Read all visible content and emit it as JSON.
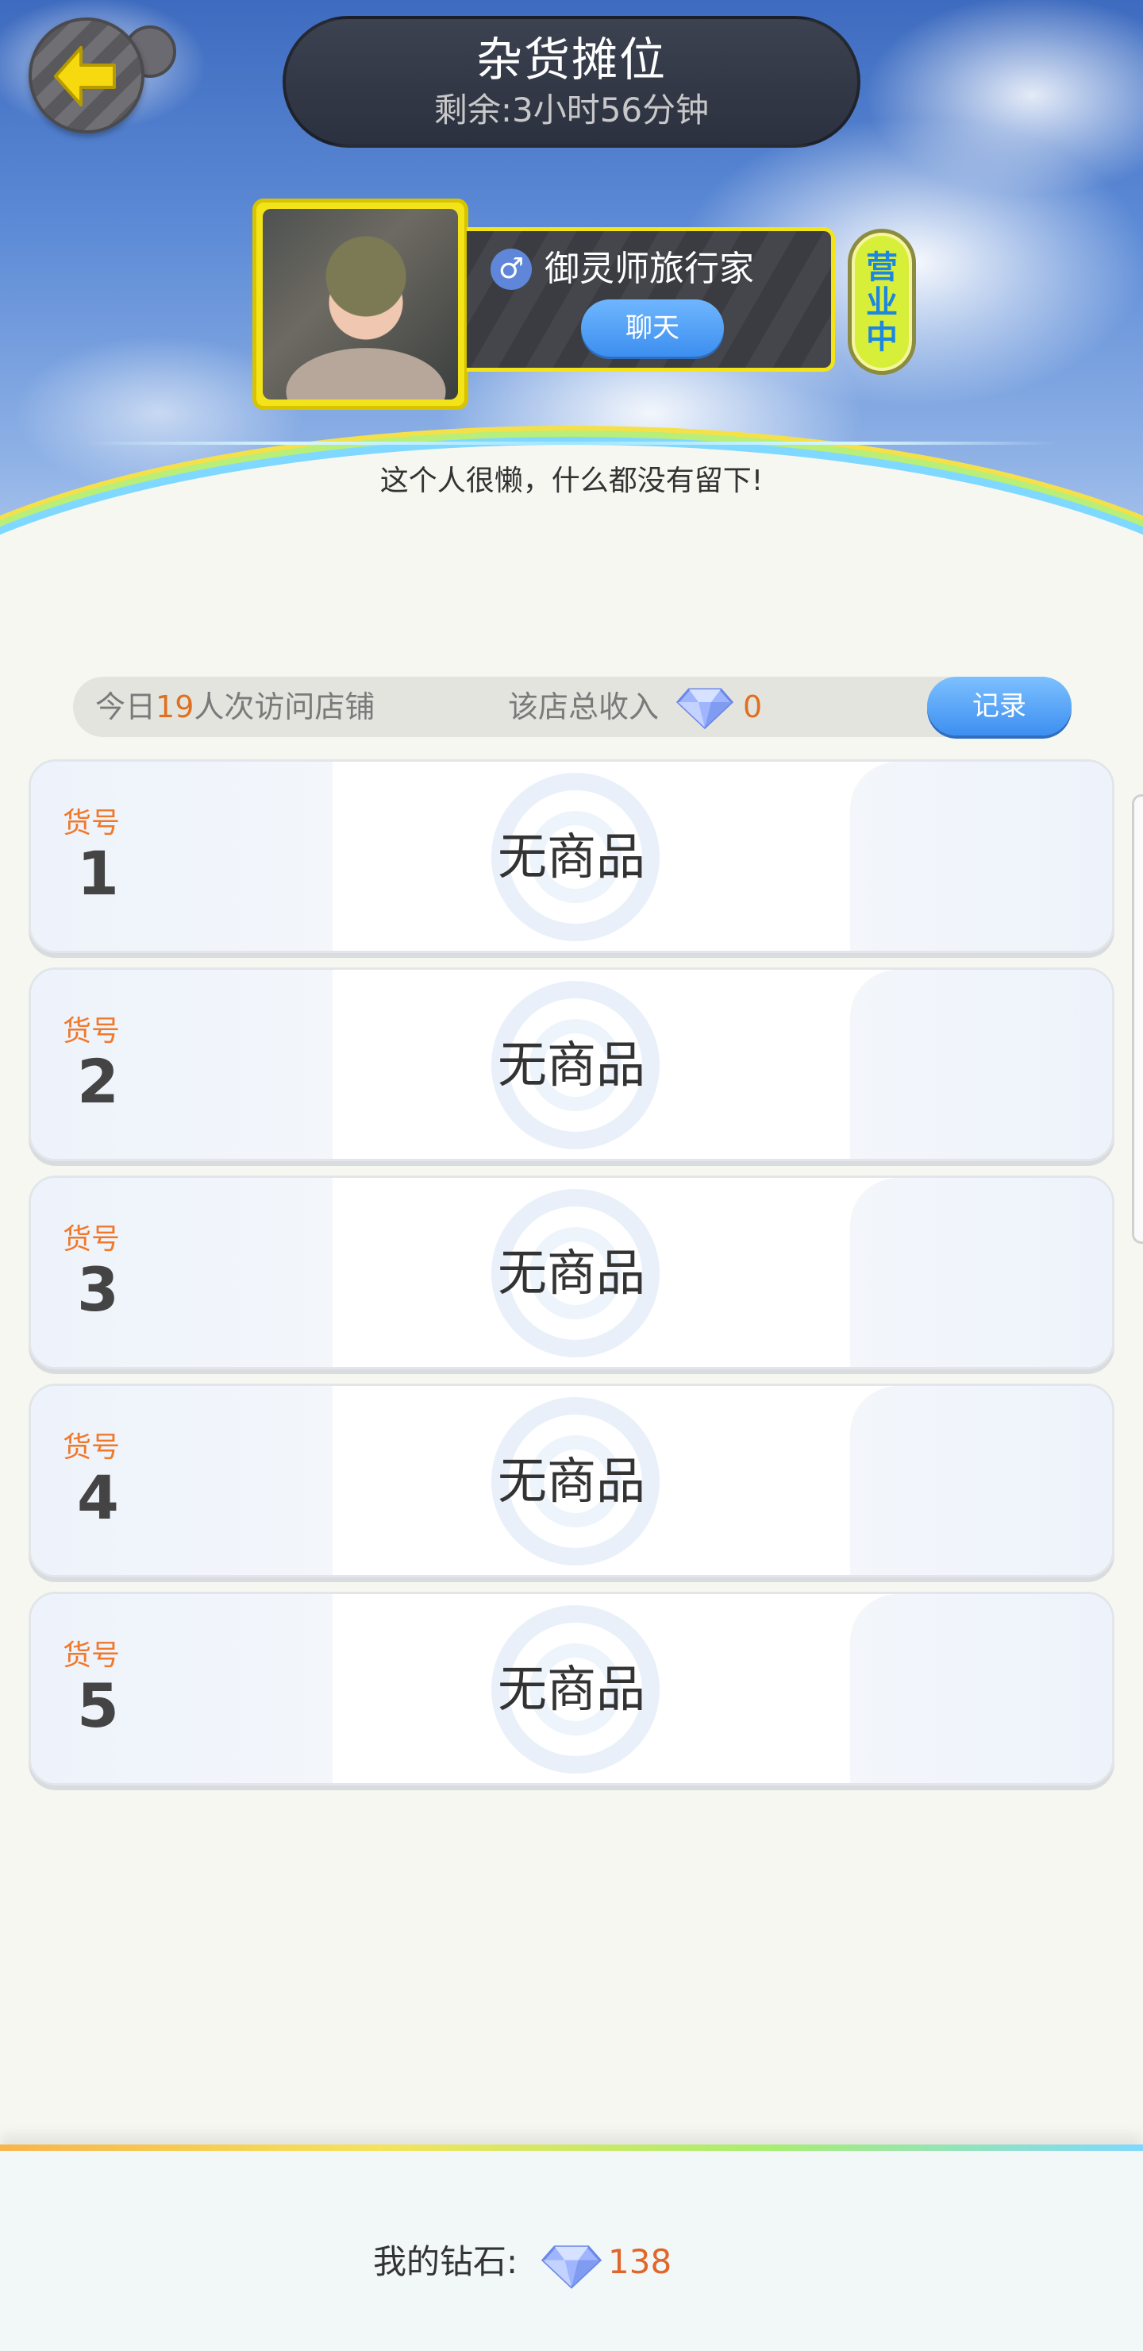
{
  "header": {
    "title": "杂货摊位",
    "remaining": "剩余:3小时56分钟"
  },
  "profile": {
    "name": "御灵师旅行家",
    "gender_symbol": "♂",
    "chat_label": "聊天",
    "status": "营业中",
    "motto": "这个人很懒，什么都没有留下!"
  },
  "stats": {
    "visits_prefix": "今日",
    "visits_count": "19",
    "visits_suffix": "人次访问店铺",
    "income_label": "该店总收入",
    "income_value": "0",
    "record_label": "记录"
  },
  "slots": [
    {
      "code_label": "货号",
      "code": "1",
      "content": "无商品"
    },
    {
      "code_label": "货号",
      "code": "2",
      "content": "无商品"
    },
    {
      "code_label": "货号",
      "code": "3",
      "content": "无商品"
    },
    {
      "code_label": "货号",
      "code": "4",
      "content": "无商品"
    },
    {
      "code_label": "货号",
      "code": "5",
      "content": "无商品"
    }
  ],
  "footer": {
    "diamonds_label": "我的钻石:",
    "diamonds_value": "138"
  },
  "colors": {
    "accent_orange": "#f0782a",
    "button_blue": "#3c8fef",
    "status_text_blue": "#1c86e0",
    "frame_yellow": "#f3e41a"
  },
  "icons": {
    "back": "arrow-left-icon",
    "gender": "male-icon",
    "diamond": "diamond-icon"
  }
}
